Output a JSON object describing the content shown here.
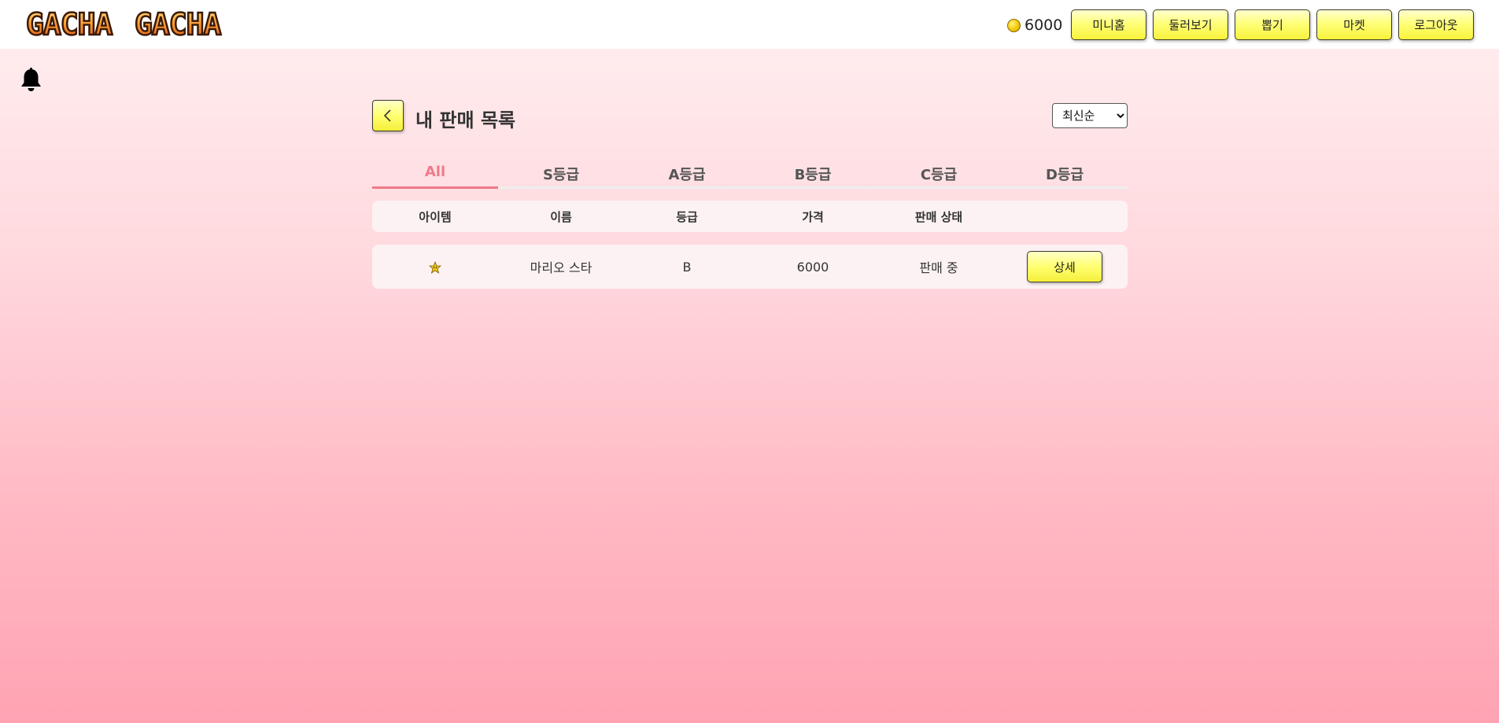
{
  "header": {
    "logo_text": "GACHA GACHA",
    "coins": "6000",
    "nav": [
      "미니홈",
      "둘러보기",
      "뽑기",
      "마켓",
      "로그아웃"
    ]
  },
  "page": {
    "title": "내 판매 목록",
    "sort": {
      "selected": "최신순",
      "options": [
        "최신순"
      ]
    }
  },
  "tabs": [
    "All",
    "S등급",
    "A등급",
    "B등급",
    "C등급",
    "D등급"
  ],
  "active_tab": "All",
  "table": {
    "headers": [
      "아이템",
      "이름",
      "등급",
      "가격",
      "판매 상태",
      ""
    ],
    "rows": [
      {
        "icon": "star-icon",
        "name": "마리오 스타",
        "grade": "B",
        "price": "6000",
        "status": "판매 중",
        "action": "상세"
      }
    ]
  },
  "colors": {
    "accent": "#f07a8a",
    "button_yellow": "#ffff70",
    "row_bg": "#fdf2f3"
  }
}
